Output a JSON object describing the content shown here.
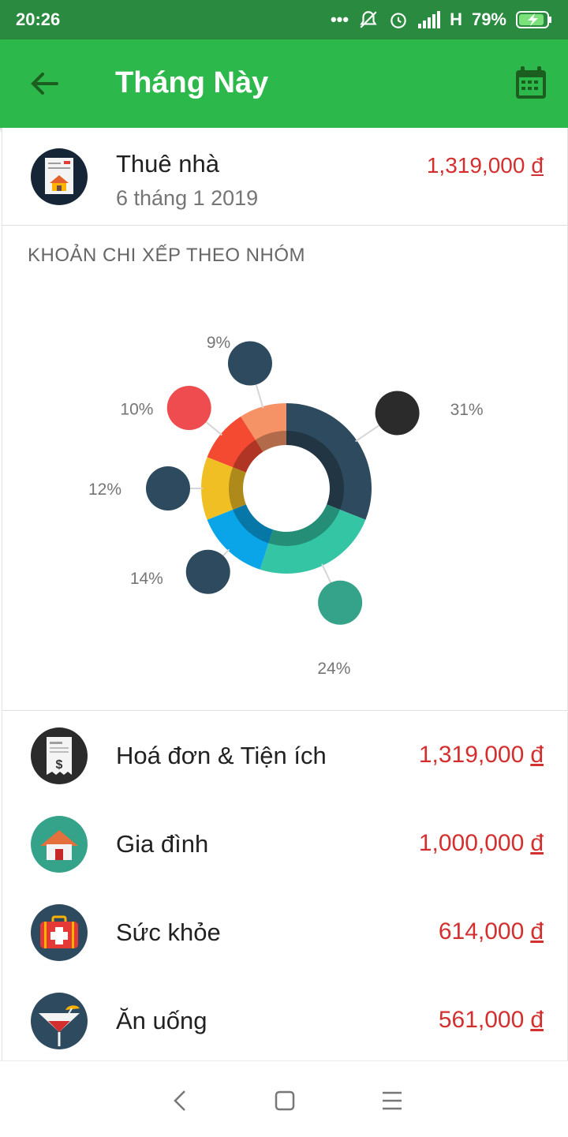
{
  "status_bar": {
    "time": "20:26",
    "signal_label": "H",
    "battery": "79%"
  },
  "app_bar": {
    "title": "Tháng Này",
    "back_icon": "arrow-back-icon",
    "action_icon": "calendar-icon"
  },
  "transaction": {
    "name": "Thuê nhà",
    "date": "6 tháng 1 2019",
    "amount": "1,319,000",
    "currency": "đ",
    "icon": "rent-bill-icon"
  },
  "chart_section": {
    "header": "KHOẢN CHI XẾP THEO NHÓM"
  },
  "chart_data": {
    "type": "pie",
    "title": "KHOẢN CHI XẾP THEO NHÓM",
    "categories": [
      "Hoá đơn & Tiện ích",
      "Gia đình",
      "Sức khỏe",
      "Ăn uống",
      "?",
      "?"
    ],
    "values": [
      31,
      24,
      14,
      12,
      10,
      9
    ],
    "labels": [
      "31%",
      "24%",
      "14%",
      "12%",
      "10%",
      "9%"
    ],
    "colors": [
      "#2e4a5e",
      "#34c5a5",
      "#0aa5e8",
      "#f0bf24",
      "#f44a32",
      "#f59367"
    ],
    "icons": [
      "bill-icon",
      "home-icon",
      "medical-kit-icon",
      "cocktail-icon",
      "heart-icon",
      "boxes-icon"
    ],
    "donut": true
  },
  "categories": [
    {
      "name": "Hoá đơn & Tiện ích",
      "amount": "1,319,000",
      "currency": "đ",
      "icon": "bill-icon"
    },
    {
      "name": "Gia đình",
      "amount": "1,000,000",
      "currency": "đ",
      "icon": "home-icon"
    },
    {
      "name": "Sức khỏe",
      "amount": "614,000",
      "currency": "đ",
      "icon": "medical-kit-icon"
    },
    {
      "name": "Ăn uống",
      "amount": "561,000",
      "currency": "đ",
      "icon": "cocktail-icon"
    }
  ],
  "nav_bar": {
    "items": [
      "back-nav-icon",
      "home-nav-icon",
      "menu-nav-icon"
    ]
  }
}
